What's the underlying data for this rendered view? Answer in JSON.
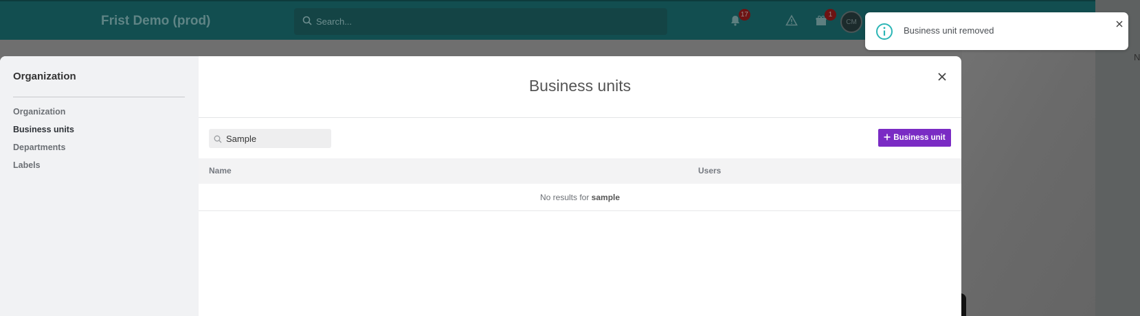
{
  "header": {
    "app_title": "Frist Demo (prod)",
    "search_placeholder": "Search...",
    "notifications_count": "17",
    "gifts_count": "1",
    "avatar_initials": "CM"
  },
  "background": {
    "right_letter": "N"
  },
  "modal": {
    "title": "Business units",
    "sidebar": {
      "title": "Organization",
      "items": [
        {
          "label": "Organization",
          "active": false
        },
        {
          "label": "Business units",
          "active": true
        },
        {
          "label": "Departments",
          "active": false
        },
        {
          "label": "Labels",
          "active": false
        }
      ]
    },
    "filter_value": "Sample",
    "add_button_label": "Business unit",
    "columns": [
      "Name",
      "Users"
    ],
    "empty_prefix": "No results for ",
    "empty_query": "sample"
  },
  "toast": {
    "message": "Business unit removed"
  },
  "colors": {
    "accent": "#7a2bc4",
    "header_bg": "#124e50",
    "toast_icon": "#2bb5b5"
  }
}
